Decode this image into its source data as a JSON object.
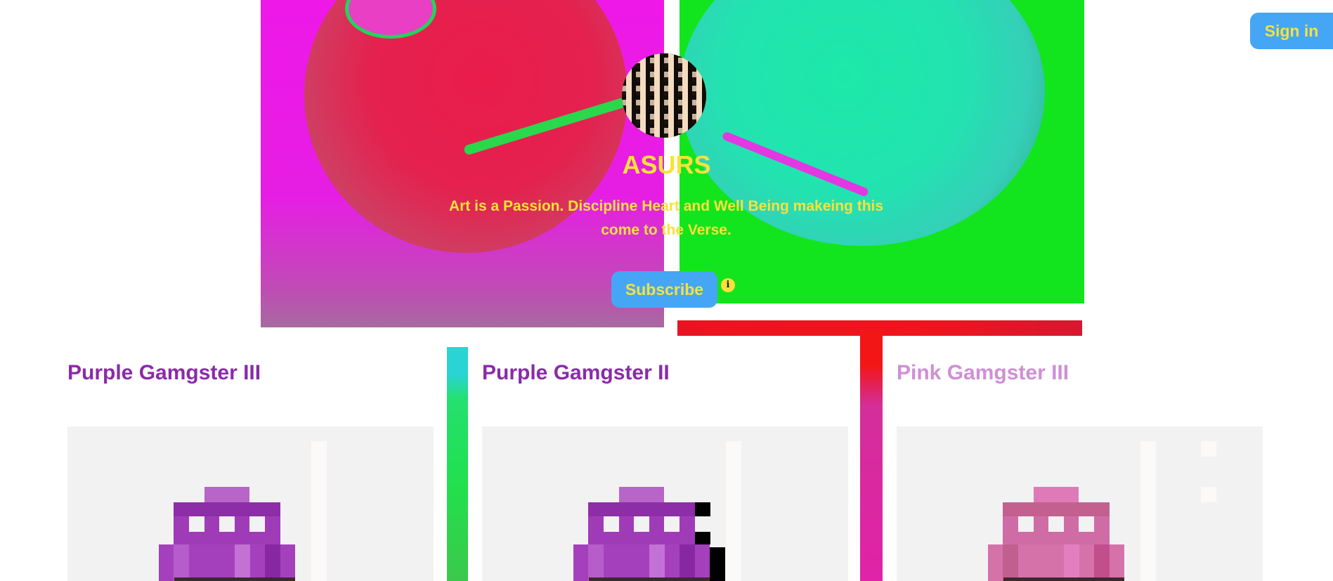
{
  "header": {
    "signin_label": "Sign in"
  },
  "profile": {
    "name": "ASURS",
    "bio": "Art is a Passion. Discipline Heart and Well Being makeing this come to the Verse.",
    "subscribe_label": "Subscribe",
    "info_icon": "info-icon"
  },
  "colors": {
    "accent_blue": "#45a6f5",
    "accent_yellow": "#f7e23a",
    "purple_title": "#8a2ba8",
    "pink_title": "#cf8fd6"
  },
  "cards": [
    {
      "title": "Purple Gamgster III"
    },
    {
      "title": "Purple Gamgster II"
    },
    {
      "title": "Pink Gamgster III"
    }
  ]
}
